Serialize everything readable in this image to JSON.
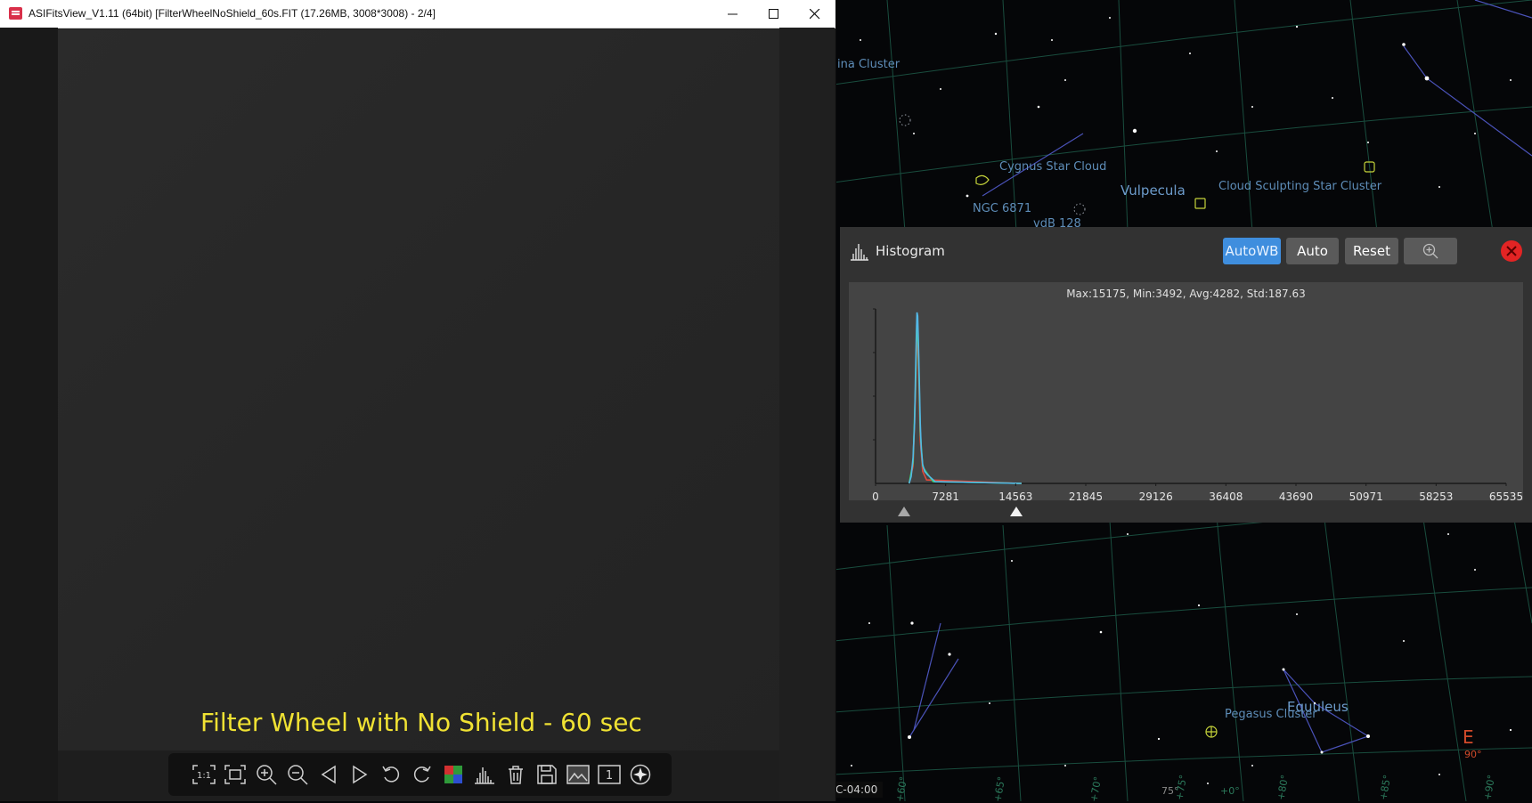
{
  "viewer": {
    "title": "ASIFitsView_V1.11 (64bit) [FilterWheelNoShield_60s.FIT (17.26MB, 3008*3008) - 2/4]",
    "caption": "Filter Wheel with No Shield - 60 sec",
    "toolbar": [
      {
        "name": "actual-size-button",
        "icon": "one-to-one-icon",
        "label": "1:1"
      },
      {
        "name": "fit-window-button",
        "icon": "fit-frame-icon"
      },
      {
        "name": "zoom-in-button",
        "icon": "zoom-in-icon"
      },
      {
        "name": "zoom-out-button",
        "icon": "zoom-out-icon"
      },
      {
        "name": "previous-button",
        "icon": "triangle-left-icon"
      },
      {
        "name": "next-button",
        "icon": "triangle-right-icon"
      },
      {
        "name": "rotate-left-button",
        "icon": "rotate-ccw-icon"
      },
      {
        "name": "rotate-right-button",
        "icon": "rotate-cw-icon"
      },
      {
        "name": "debayer-button",
        "icon": "rgb-grid-icon"
      },
      {
        "name": "histogram-button",
        "icon": "histogram-icon"
      },
      {
        "name": "delete-button",
        "icon": "trash-icon"
      },
      {
        "name": "save-button",
        "icon": "floppy-icon"
      },
      {
        "name": "image-info-button",
        "icon": "image-icon"
      },
      {
        "name": "single-frame-button",
        "icon": "frame-one-icon",
        "label": "1"
      },
      {
        "name": "star-button",
        "icon": "star-circle-icon"
      }
    ]
  },
  "histogram": {
    "title": "Histogram",
    "buttons": {
      "autowb": "AutoWB",
      "auto": "Auto",
      "reset": "Reset"
    },
    "stats": "Max:15175, Min:3492, Avg:4282, Std:187.63",
    "accent": "#3f8ede",
    "sliders": {
      "low": 3492,
      "high": 15175
    },
    "chart_data": {
      "type": "area",
      "xlim": [
        0,
        65535
      ],
      "x_ticks": [
        "0",
        "7281",
        "14563",
        "21845",
        "29126",
        "36408",
        "43690",
        "50971",
        "58253",
        "65535"
      ],
      "series": [
        {
          "color": "#53b8e6",
          "x": [
            3492,
            3700,
            3900,
            4050,
            4150,
            4250,
            4300,
            4380,
            4450,
            4550,
            4650,
            4750,
            4900,
            5100,
            5400,
            5800,
            6200,
            15175
          ],
          "values": [
            0,
            0.04,
            0.15,
            0.35,
            0.62,
            0.88,
            0.99,
            0.97,
            0.82,
            0.58,
            0.35,
            0.2,
            0.11,
            0.07,
            0.05,
            0.03,
            0.01,
            0
          ]
        },
        {
          "color": "#3fd36b",
          "x": [
            3492,
            3900,
            4150,
            4300,
            4450,
            4650,
            4900,
            5200,
            5600,
            6000,
            15175
          ],
          "values": [
            0,
            0.12,
            0.55,
            0.95,
            0.78,
            0.3,
            0.1,
            0.07,
            0.04,
            0.01,
            0
          ]
        },
        {
          "color": "#e0493c",
          "x": [
            3492,
            3900,
            4150,
            4300,
            4450,
            4650,
            4900,
            5300,
            15175
          ],
          "values": [
            0,
            0.1,
            0.5,
            0.9,
            0.7,
            0.25,
            0.07,
            0.02,
            0
          ]
        }
      ]
    }
  },
  "sky": {
    "labels": [
      {
        "text": "ina Cluster",
        "cls": ""
      },
      {
        "text": "Cygnus Star Cloud",
        "cls": ""
      },
      {
        "text": "NGC 6871",
        "cls": ""
      },
      {
        "text": "vdB 128",
        "cls": ""
      },
      {
        "text": "Vulpecula",
        "cls": "big"
      },
      {
        "text": "Cloud Sculpting Star Cluster",
        "cls": ""
      },
      {
        "text": "Equuleus",
        "cls": "big"
      },
      {
        "text": "Pegasus Cluster",
        "cls": ""
      }
    ],
    "timezone": "C-04:00",
    "compass": "E",
    "compass_deg": "90°",
    "azimuth_marks": [
      "+60°",
      "+65°",
      "75°",
      "+70°",
      "+75°",
      "+0°",
      "+80°",
      "+85°",
      "+90°"
    ]
  }
}
